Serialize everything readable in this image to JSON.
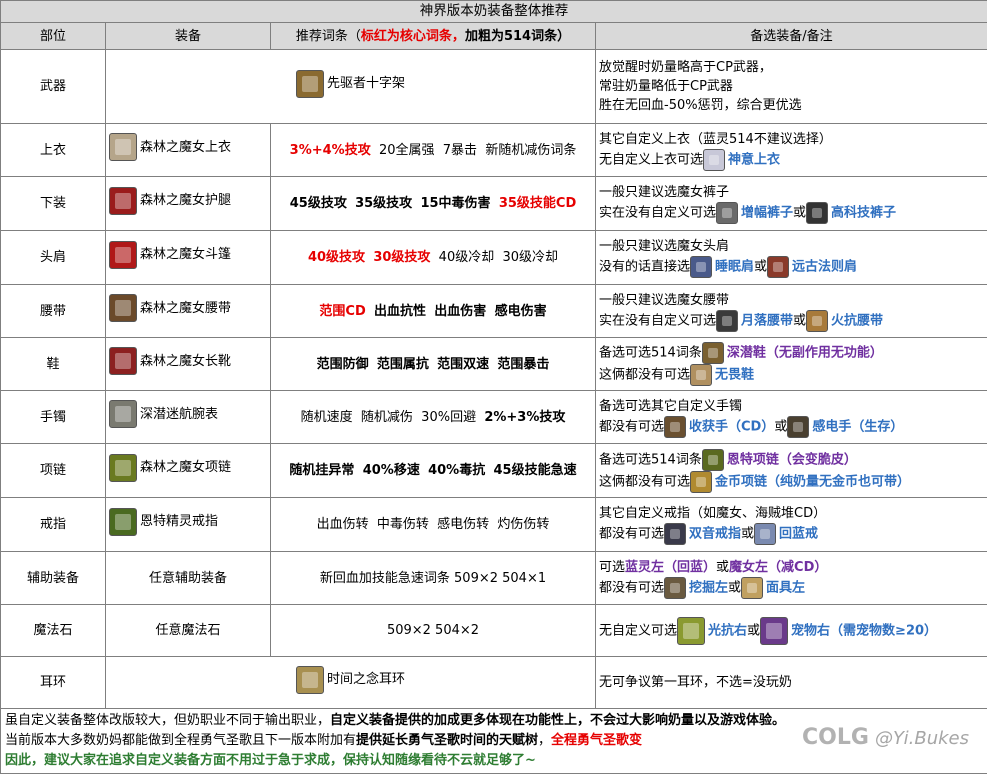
{
  "title": "神界版本奶装备整体推荐",
  "headers": {
    "slot": "部位",
    "equip": "装备",
    "affix_pre": "推荐词条（",
    "affix_red": "标红为核心词条，",
    "affix_bold": "加粗为514词条）",
    "alt": "备选装备/备注"
  },
  "rows": {
    "weapon": {
      "slot": "武器",
      "equip": "先驱者十字架",
      "notes": [
        "放觉醒时奶量略高于CP武器，",
        "常驻奶量略低于CP武器",
        "胜在无回血-50%惩罚，综合更优选"
      ]
    },
    "top": {
      "slot": "上衣",
      "equip": "森林之魔女上衣",
      "a1": "3%+4%技攻",
      "a2": "20全属强",
      "a3": "7暴击",
      "a4": "新随机减伤词条",
      "n1": "其它自定义上衣（蓝灵514不建议选择）",
      "n2_pre": "无自定义上衣可选",
      "n2_item": "神意上衣"
    },
    "pants": {
      "slot": "下装",
      "equip": "森林之魔女护腿",
      "a1": "45级技攻",
      "a2": "35级技攻",
      "a3": "15中毒伤害",
      "a4": "35级技能CD",
      "n1": "一般只建议选魔女裤子",
      "n2_pre": "实在没有自定义可选",
      "n2_item1": "增幅裤子",
      "n2_mid": "或",
      "n2_item2": "高科技裤子"
    },
    "shoulder": {
      "slot": "头肩",
      "equip": "森林之魔女斗篷",
      "a1": "40级技攻",
      "a2": "30级技攻",
      "a3": "40级冷却",
      "a4": "30级冷却",
      "n1": "一般只建议选魔女头肩",
      "n2_pre": "没有的话直接选",
      "n2_item1": "睡眠肩",
      "n2_mid": "或",
      "n2_item2": "远古法则肩"
    },
    "belt": {
      "slot": "腰带",
      "equip": "森林之魔女腰带",
      "a1": "范围CD",
      "a2": "出血抗性",
      "a3": "出血伤害",
      "a4": "感电伤害",
      "n1": "一般只建议选魔女腰带",
      "n2_pre": "实在没有自定义可选",
      "n2_item1": "月落腰带",
      "n2_mid": "或",
      "n2_item2": "火抗腰带"
    },
    "shoes": {
      "slot": "鞋",
      "equip": "森林之魔女长靴",
      "a1": "范围防御",
      "a2": "范围属抗",
      "a3": "范围双速",
      "a4": "范围暴击",
      "n1_pre": "备选可选514词条",
      "n1_item": "深潜鞋（无副作用无功能）",
      "n2_pre": "这俩都没有可选",
      "n2_item": "无畏鞋"
    },
    "bracelet": {
      "slot": "手镯",
      "equip": "深潜迷航腕表",
      "a1": "随机速度",
      "a2": "随机减伤",
      "a3": "30%回避",
      "a4": "2%+3%技攻",
      "n1": "备选可选其它自定义手镯",
      "n2_pre": "都没有可选",
      "n2_item1": "收获手（CD）",
      "n2_mid": "或",
      "n2_item2": "感电手（生存）"
    },
    "necklace": {
      "slot": "项链",
      "equip": "森林之魔女项链",
      "a1": "随机挂异常",
      "a2": "40%移速",
      "a3": "40%毒抗",
      "a4": "45级技能急速",
      "n1_pre": "备选可选514词条",
      "n1_item": "恩特项链（会变脆皮）",
      "n2_pre": "这俩都没有可选",
      "n2_item": "金币项链（纯奶量无金币也可带）"
    },
    "ring": {
      "slot": "戒指",
      "equip": "恩特精灵戒指",
      "a1": "出血伤转",
      "a2": "中毒伤转",
      "a3": "感电伤转",
      "a4": "灼伤伤转",
      "n1": "其它自定义戒指（如魔女、海贼堆CD）",
      "n2_pre": "都没有可选",
      "n2_item1": "双音戒指",
      "n2_mid": "或",
      "n2_item2": "回蓝戒"
    },
    "support": {
      "slot": "辅助装备",
      "equip": "任意辅助装备",
      "affix": "新回血加技能急速词条  509×2  504×1",
      "n1_pre": "可选",
      "n1_item1": "蓝灵左（回蓝）",
      "n1_mid": "或",
      "n1_item2": "魔女左（减CD）",
      "n2_pre": "都没有可选",
      "n2_item1": "挖掘左",
      "n2_mid": "或",
      "n2_item2": "面具左"
    },
    "stone": {
      "slot": "魔法石",
      "equip": "任意魔法石",
      "affix": "509×2  504×2",
      "n1_pre": "无自定义可选",
      "n1_item1": "光抗右",
      "n1_mid": "或",
      "n1_item2": "宠物右（需宠物数≥20）"
    },
    "earring": {
      "slot": "耳环",
      "equip": "时间之念耳环",
      "note": "无可争议第一耳环，不选=没玩奶"
    }
  },
  "footer": {
    "l1_a": "虽自定义装备整体改版较大，但奶职业不同于输出职业，",
    "l1_b": "自定义装备提供的加成更多体现在功能性上，不会过大影响奶量以及游戏体验。",
    "l2_a": "当前版本大多数奶妈都能做到全程勇气圣歌且下一版本附加有",
    "l2_b": "提供延长勇气圣歌时间的天赋树",
    "l2_c": "，",
    "l2_d": "全程勇气圣歌变",
    "l3": "因此，建议大家在追求自定义装备方面不用过于急于求成，保持认知随缘看待不云就足够了~"
  },
  "watermark": {
    "logo": "COLG",
    "handle": "@Yi.Bukes"
  },
  "icon_colors": {
    "weapon": "#8a6a30",
    "top": "#b5a58a",
    "pants": "#9a1c1c",
    "shoulder": "#b01818",
    "belt": "#6b4a2a",
    "shoes": "#8c2020",
    "bracelet": "#7a7a70",
    "necklace": "#6a7a20",
    "ring": "#4a6a20",
    "earring": "#a89050"
  }
}
